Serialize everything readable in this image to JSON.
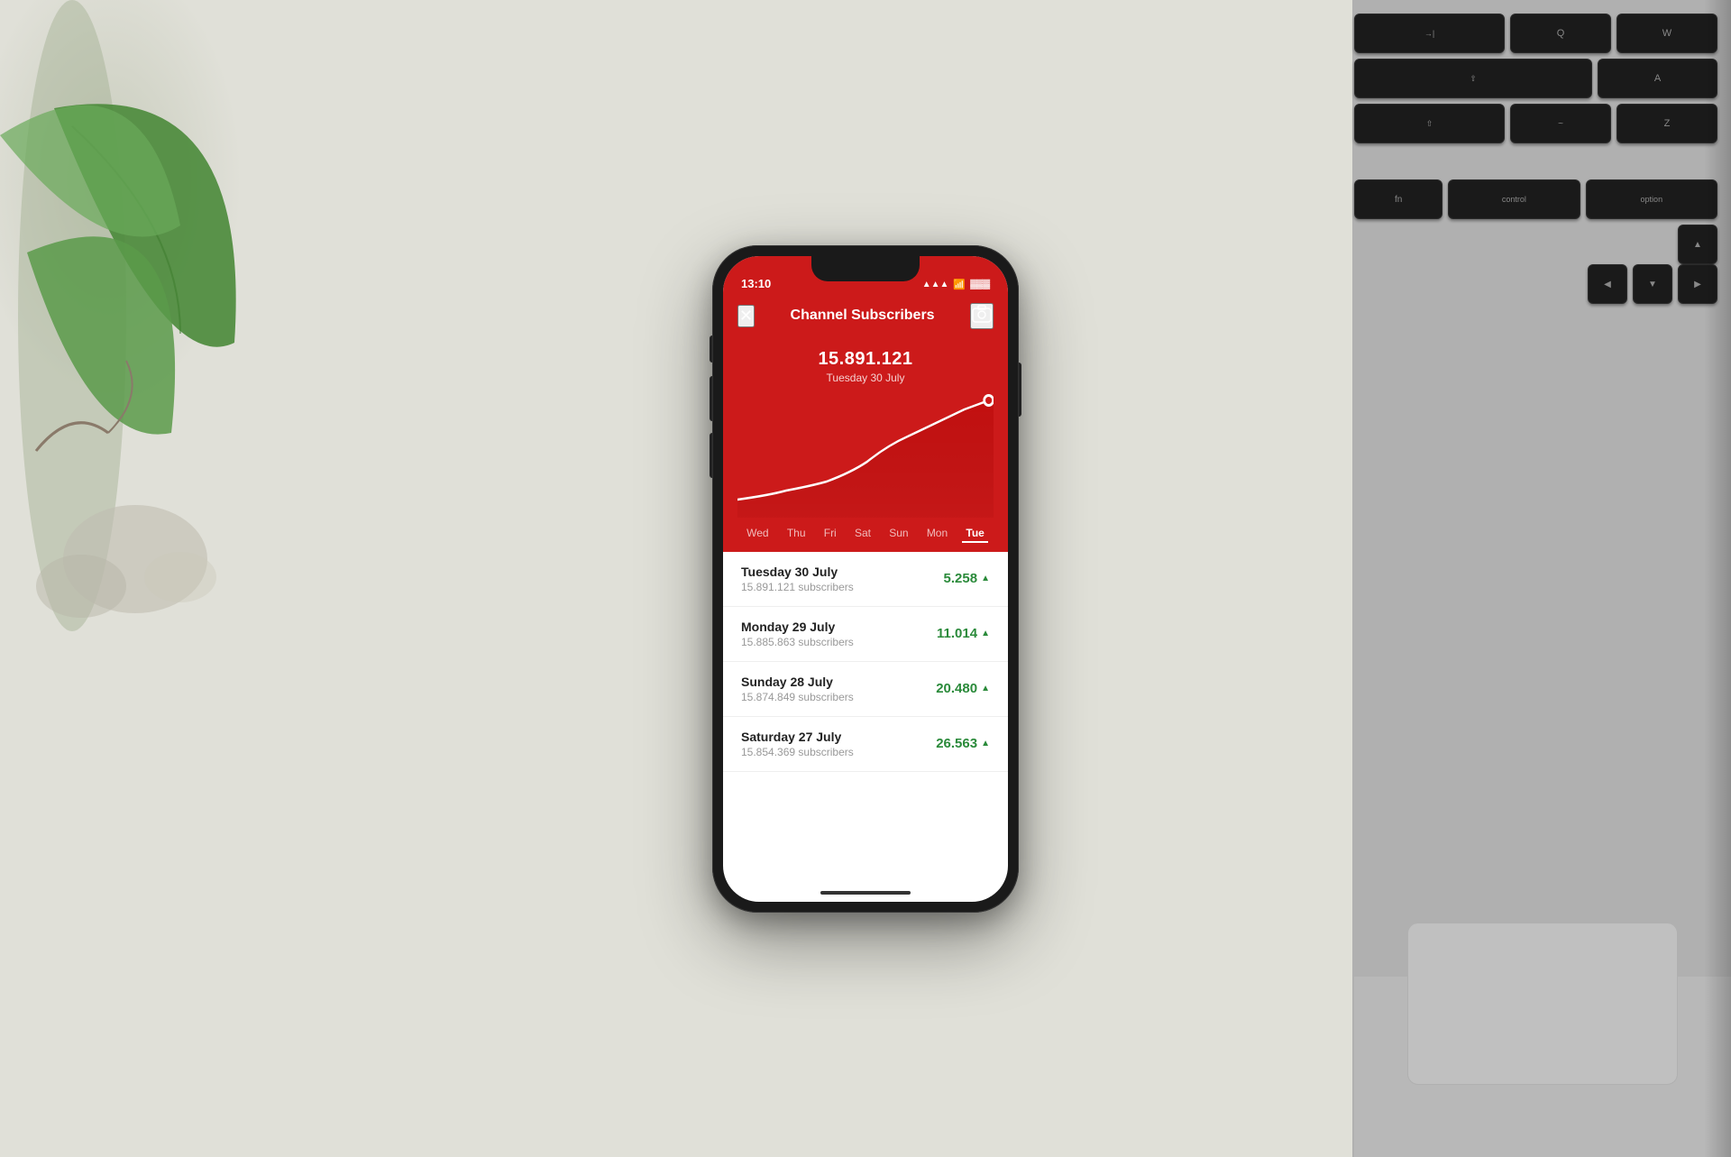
{
  "background": {
    "color": "#e0e0d8"
  },
  "phone": {
    "status_bar": {
      "time": "13:10",
      "signal": "▲",
      "wifi": "wifi",
      "battery": "battery"
    },
    "header": {
      "close_button": "✕",
      "title": "Channel Subscribers",
      "camera_button": "⊡"
    },
    "chart": {
      "total_value": "15.891.121",
      "selected_date": "Tuesday 30 July"
    },
    "day_tabs": [
      {
        "label": "Wed",
        "active": false
      },
      {
        "label": "Thu",
        "active": false
      },
      {
        "label": "Fri",
        "active": false
      },
      {
        "label": "Sat",
        "active": false
      },
      {
        "label": "Sun",
        "active": false
      },
      {
        "label": "Mon",
        "active": false
      },
      {
        "label": "Tue",
        "active": true
      }
    ],
    "stats": [
      {
        "date": "Tuesday 30 July",
        "subscribers": "15.891.121 subscribers",
        "change": "5.258",
        "positive": true
      },
      {
        "date": "Monday 29 July",
        "subscribers": "15.885.863 subscribers",
        "change": "11.014",
        "positive": true
      },
      {
        "date": "Sunday 28 July",
        "subscribers": "15.874.849 subscribers",
        "change": "20.480",
        "positive": true
      },
      {
        "date": "Saturday 27 July",
        "subscribers": "15.854.369 subscribers",
        "change": "26.563",
        "positive": true
      }
    ]
  },
  "keyboard": {
    "keys_row1": [
      "→|",
      "Q",
      "W"
    ],
    "keys_row2": [
      "⇧",
      "A"
    ],
    "keys_row3": [
      "⇧",
      "~",
      "Z"
    ],
    "special_keys": [
      "fn",
      "control",
      "option"
    ]
  },
  "detection": {
    "option_key": "option"
  }
}
